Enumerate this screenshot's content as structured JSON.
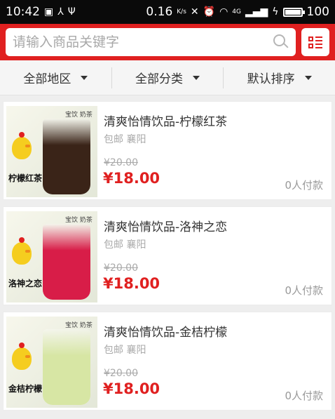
{
  "status_bar": {
    "time": "10:42",
    "speed": "0.16",
    "speed_unit": "K/s",
    "network": "4G",
    "battery": "100",
    "battery_level": 1.0
  },
  "search": {
    "placeholder": "请输入商品关键字"
  },
  "filters": [
    {
      "label": "全部地区"
    },
    {
      "label": "全部分类"
    },
    {
      "label": "默认排序"
    }
  ],
  "products": [
    {
      "title": "清爽怡情饮品-柠檬红茶",
      "shipping": "包邮",
      "location": "襄阳",
      "old_price": "¥20.00",
      "price": "¥18.00",
      "sales": "0人付款",
      "thumb_label": "柠檬红茶",
      "thumb_brand": "宝饮 奶茶",
      "drink_color": "#3a2418"
    },
    {
      "title": "清爽怡情饮品-洛神之恋",
      "shipping": "包邮",
      "location": "襄阳",
      "old_price": "¥20.00",
      "price": "¥18.00",
      "sales": "0人付款",
      "thumb_label": "洛神之恋",
      "thumb_brand": "宝饮 奶茶",
      "drink_color": "#d81d48"
    },
    {
      "title": "清爽怡情饮品-金桔柠檬",
      "shipping": "包邮",
      "location": "襄阳",
      "old_price": "¥20.00",
      "price": "¥18.00",
      "sales": "0人付款",
      "thumb_label": "金桔柠檬",
      "thumb_brand": "宝饮 奶茶",
      "drink_color": "#d7e6a4"
    }
  ],
  "colors": {
    "brand": "#e02020",
    "price": "#e02020"
  }
}
